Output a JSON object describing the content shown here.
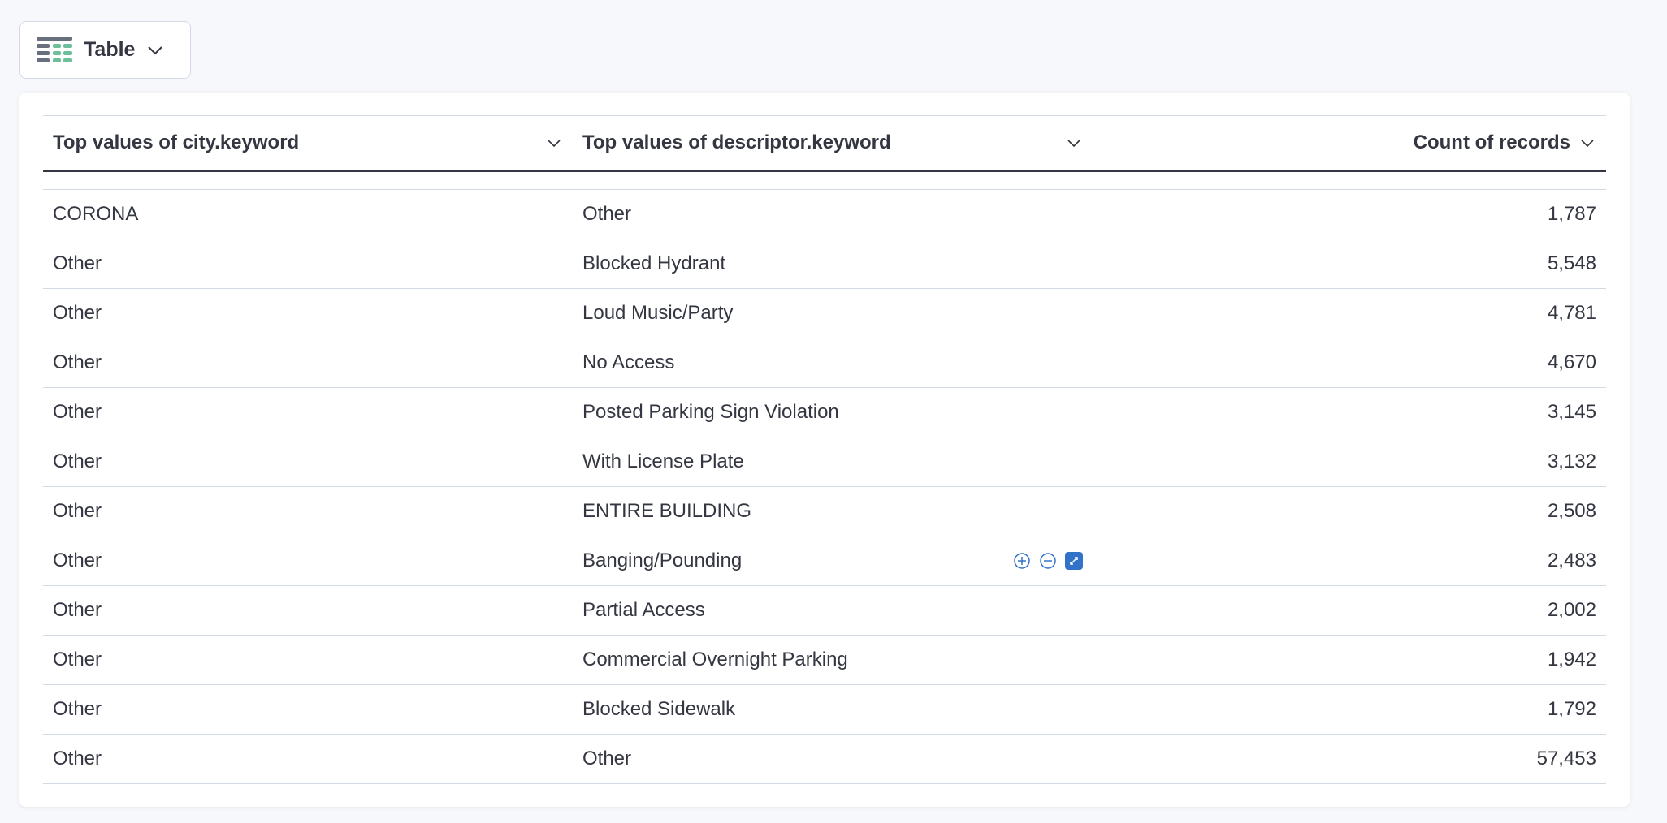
{
  "chart_switcher": {
    "label": "Table",
    "icon": "table-vis-icon"
  },
  "table": {
    "columns": [
      "Top values of city.keyword",
      "Top values of descriptor.keyword",
      "Count of records"
    ],
    "rows": [
      [
        "CORONA",
        "Other",
        "1,787"
      ],
      [
        "Other",
        "Blocked Hydrant",
        "5,548"
      ],
      [
        "Other",
        "Loud Music/Party",
        "4,781"
      ],
      [
        "Other",
        "No Access",
        "4,670"
      ],
      [
        "Other",
        "Posted Parking Sign Violation",
        "3,145"
      ],
      [
        "Other",
        "With License Plate",
        "3,132"
      ],
      [
        "Other",
        "ENTIRE BUILDING",
        "2,508"
      ],
      [
        "Other",
        "Banging/Pounding",
        "2,483"
      ],
      [
        "Other",
        "Partial Access",
        "2,002"
      ],
      [
        "Other",
        "Commercial Overnight Parking",
        "1,942"
      ],
      [
        "Other",
        "Blocked Sidewalk",
        "1,792"
      ],
      [
        "Other",
        "Other",
        "57,453"
      ]
    ],
    "hover_row": 7,
    "accent": "#3272c9"
  }
}
